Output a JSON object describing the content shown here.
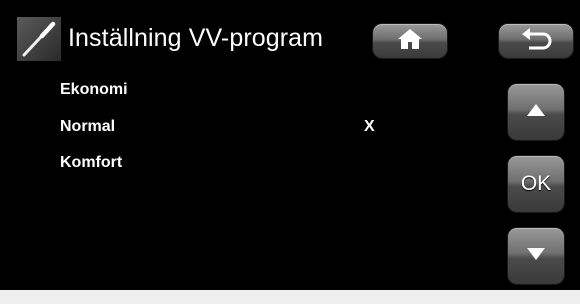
{
  "header": {
    "title": "Inställning VV-program",
    "icon": "thermometer-probe-icon"
  },
  "nav": {
    "home_icon": "home-icon",
    "back_icon": "back-arrow-icon"
  },
  "menu": {
    "items": [
      {
        "label": "Ekonomi",
        "mark": ""
      },
      {
        "label": "Normal",
        "mark": "X"
      },
      {
        "label": "Komfort",
        "mark": ""
      }
    ]
  },
  "controls": {
    "up_icon": "arrow-up-icon",
    "ok_label": "OK",
    "down_icon": "arrow-down-icon"
  }
}
